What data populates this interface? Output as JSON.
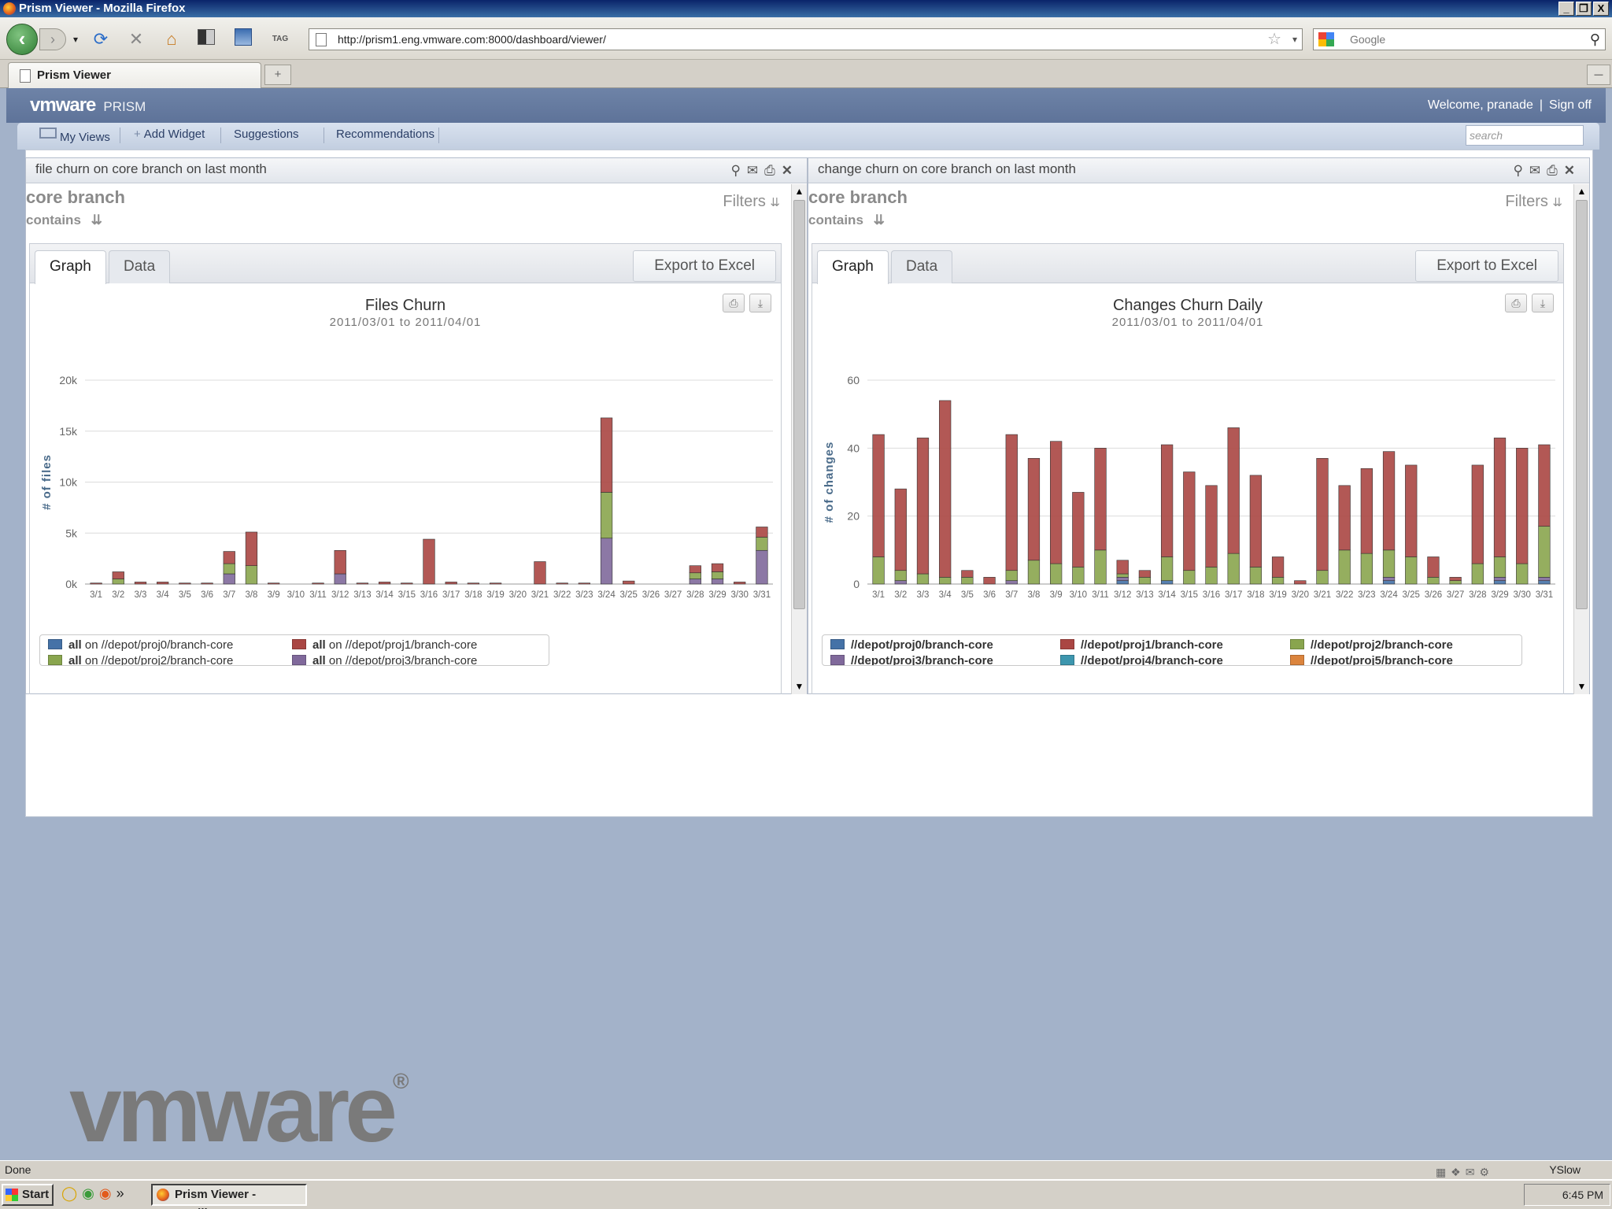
{
  "window": {
    "title": "Prism Viewer - Mozilla Firefox",
    "min": "_",
    "max": "❐",
    "close": "X"
  },
  "browser": {
    "url": "http://prism1.eng.vmware.com:8000/dashboard/viewer/",
    "search_placeholder": "Google",
    "tab_title": "Prism Viewer",
    "new_tab": "+",
    "tab_list": "—"
  },
  "app": {
    "logo": "vmware",
    "product": "PRISM",
    "welcome": "Welcome, pranade",
    "sign_off": "Sign off",
    "menu": {
      "my_views": "My Views",
      "add_widget": "Add Widget",
      "suggestions": "Suggestions",
      "recommendations": "Recommendations"
    },
    "search_placeholder": "search"
  },
  "widgets": [
    {
      "title": "file churn on core branch on last month",
      "branch": "core branch",
      "contains": "contains",
      "filters": "Filters",
      "tabs": [
        "Graph",
        "Data"
      ],
      "export": "Export to Excel"
    },
    {
      "title": "change churn on core branch on last month",
      "branch": "core branch",
      "contains": "contains",
      "filters": "Filters",
      "tabs": [
        "Graph",
        "Data"
      ],
      "export": "Export to Excel"
    }
  ],
  "chart_data": [
    {
      "type": "bar",
      "stacked": true,
      "title": "Files Churn",
      "subtitle_from": "2011/03/01",
      "subtitle_to_word": "to",
      "subtitle_to": "2011/04/01",
      "ylabel": "# of files",
      "ylim": [
        0,
        20000
      ],
      "yticks": [
        0,
        5000,
        10000,
        15000,
        20000
      ],
      "ytick_labels": [
        "0k",
        "5k",
        "10k",
        "15k",
        "20k"
      ],
      "grid": true,
      "legend_position": "bottom-left",
      "categories": [
        "3/1",
        "3/2",
        "3/3",
        "3/4",
        "3/5",
        "3/6",
        "3/7",
        "3/8",
        "3/9",
        "3/10",
        "3/11",
        "3/12",
        "3/13",
        "3/14",
        "3/15",
        "3/16",
        "3/17",
        "3/18",
        "3/19",
        "3/20",
        "3/21",
        "3/22",
        "3/23",
        "3/24",
        "3/25",
        "3/26",
        "3/27",
        "3/28",
        "3/29",
        "3/30",
        "3/31"
      ],
      "tick_labels": [
        "3/1",
        "3/2",
        "3/3",
        "3/4",
        "3/5",
        "3/6",
        "3/7",
        "3/8",
        "3/9",
        "3/10",
        "3/11",
        "3/12",
        "3/13",
        "3/14",
        "3/15",
        "3/16",
        "3/17",
        "3/18",
        "3/19",
        "3/20",
        "3/21",
        "3/22",
        "3/23",
        "3/24",
        "3/25",
        "3/26",
        "3/27",
        "3/28",
        "3/29",
        "3/30",
        "3/31"
      ],
      "series": [
        {
          "name": "//depot/proj0/branch-core",
          "prefix": "all",
          "mid": "on",
          "color": "#4572a7",
          "values": [
            0,
            0,
            0,
            0,
            0,
            0,
            0,
            0,
            0,
            0,
            0,
            0,
            0,
            0,
            0,
            0,
            0,
            0,
            0,
            0,
            0,
            0,
            0,
            0,
            0,
            0,
            0,
            0,
            0,
            0,
            0
          ]
        },
        {
          "name": "//depot/proj3/branch-core",
          "prefix": "all",
          "mid": "on",
          "color": "#80699b",
          "values": [
            0,
            0,
            0,
            0,
            0,
            0,
            1000,
            0,
            0,
            0,
            0,
            1000,
            0,
            0,
            0,
            0,
            0,
            0,
            0,
            0,
            0,
            0,
            0,
            4500,
            0,
            0,
            0,
            500,
            500,
            0,
            3300
          ]
        },
        {
          "name": "//depot/proj2/branch-core",
          "prefix": "all",
          "mid": "on",
          "color": "#89a54e",
          "values": [
            0,
            500,
            0,
            0,
            0,
            0,
            1000,
            1800,
            0,
            0,
            0,
            0,
            0,
            0,
            0,
            0,
            0,
            0,
            0,
            0,
            0,
            0,
            0,
            4500,
            0,
            0,
            0,
            600,
            700,
            0,
            1300
          ]
        },
        {
          "name": "//depot/proj1/branch-core",
          "prefix": "all",
          "mid": "on",
          "color": "#aa4643",
          "values": [
            100,
            700,
            200,
            200,
            100,
            100,
            1200,
            3300,
            100,
            0,
            100,
            2300,
            100,
            200,
            100,
            4400,
            200,
            100,
            100,
            0,
            2200,
            100,
            100,
            7300,
            300,
            0,
            0,
            700,
            800,
            200,
            1000
          ]
        }
      ],
      "legend": [
        {
          "prefix": "all",
          "mid": "on",
          "name": "//depot/proj0/branch-core",
          "color": "#4572a7"
        },
        {
          "prefix": "all",
          "mid": "on",
          "name": "//depot/proj1/branch-core",
          "color": "#aa4643"
        },
        {
          "prefix": "all",
          "mid": "on",
          "name": "//depot/proj2/branch-core",
          "color": "#89a54e"
        },
        {
          "prefix": "all",
          "mid": "on",
          "name": "//depot/proj3/branch-core",
          "color": "#80699b"
        }
      ]
    },
    {
      "type": "bar",
      "stacked": true,
      "title": "Changes Churn Daily",
      "subtitle_from": "2011/03/01",
      "subtitle_to_word": "to",
      "subtitle_to": "2011/04/01",
      "ylabel": "# of changes",
      "ylim": [
        0,
        60
      ],
      "yticks": [
        0,
        20,
        40,
        60
      ],
      "ytick_labels": [
        "0",
        "20",
        "40",
        "60"
      ],
      "grid": true,
      "legend_position": "bottom",
      "categories": [
        "3/1",
        "3/2",
        "3/3",
        "3/4",
        "3/5",
        "3/6",
        "3/7",
        "3/8",
        "3/9",
        "3/10",
        "3/11",
        "3/12",
        "3/13",
        "3/14",
        "3/15",
        "3/16",
        "3/17",
        "3/18",
        "3/19",
        "3/20",
        "3/21",
        "3/22",
        "3/23",
        "3/24",
        "3/25",
        "3/26",
        "3/27",
        "3/28",
        "3/29",
        "3/30",
        "3/31"
      ],
      "tick_labels": [
        "3/1",
        "3/2",
        "3/3",
        "3/4",
        "3/5",
        "3/6",
        "3/7",
        "3/8",
        "3/9",
        "3/10",
        "3/11",
        "3/12",
        "3/13",
        "3/14",
        "3/15",
        "3/16",
        "3/17",
        "3/18",
        "3/19",
        "3/20",
        "3/21",
        "3/22",
        "3/23",
        "3/24",
        "3/25",
        "3/26",
        "3/27",
        "3/28",
        "3/29",
        "3/30",
        "3/31"
      ],
      "series": [
        {
          "name": "//depot/proj0/branch-core",
          "color": "#4572a7",
          "values": [
            0,
            0,
            0,
            0,
            0,
            0,
            0,
            0,
            0,
            0,
            0,
            1,
            0,
            1,
            0,
            0,
            0,
            0,
            0,
            0,
            0,
            0,
            0,
            1,
            0,
            0,
            0,
            0,
            1,
            0,
            1
          ]
        },
        {
          "name": "//depot/proj3/branch-core",
          "color": "#80699b",
          "values": [
            0,
            1,
            0,
            0,
            0,
            0,
            1,
            0,
            0,
            0,
            0,
            1,
            0,
            0,
            0,
            0,
            0,
            0,
            0,
            0,
            0,
            0,
            0,
            1,
            0,
            0,
            0,
            0,
            1,
            0,
            1
          ]
        },
        {
          "name": "//depot/proj2/branch-core",
          "color": "#89a54e",
          "values": [
            8,
            3,
            3,
            2,
            2,
            0,
            3,
            7,
            6,
            5,
            10,
            1,
            2,
            7,
            4,
            5,
            9,
            5,
            2,
            0,
            4,
            10,
            9,
            8,
            8,
            2,
            1,
            6,
            6,
            6,
            15
          ]
        },
        {
          "name": "//depot/proj1/branch-core",
          "color": "#aa4643",
          "values": [
            36,
            24,
            40,
            52,
            2,
            2,
            40,
            30,
            36,
            22,
            30,
            4,
            2,
            33,
            29,
            24,
            37,
            27,
            6,
            1,
            33,
            19,
            25,
            29,
            27,
            6,
            1,
            29,
            35,
            34,
            24
          ]
        }
      ],
      "legend": [
        {
          "name": "//depot/proj0/branch-core",
          "color": "#4572a7"
        },
        {
          "name": "//depot/proj1/branch-core",
          "color": "#aa4643"
        },
        {
          "name": "//depot/proj2/branch-core",
          "color": "#89a54e"
        },
        {
          "name": "//depot/proj3/branch-core",
          "color": "#80699b"
        },
        {
          "name": "//depot/proj4/branch-core",
          "color": "#3d96ae"
        },
        {
          "name": "//depot/proj5/branch-core",
          "color": "#db843d"
        }
      ]
    }
  ],
  "watermark": "vmware",
  "watermark_reg": "®",
  "status": {
    "text": "Done",
    "yslow": "YSlow"
  },
  "taskbar": {
    "start": "Start",
    "app": "Prism Viewer - Mozilla...",
    "clock": "6:45 PM",
    "more": "»"
  }
}
